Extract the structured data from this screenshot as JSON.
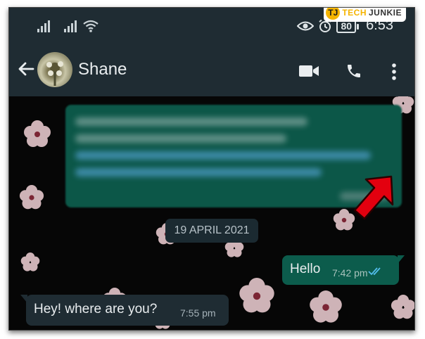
{
  "status_bar": {
    "time": "6:53",
    "battery": "80",
    "icons": [
      "signal-icon",
      "signal-icon",
      "wifi-icon",
      "eye-icon",
      "alarm-icon",
      "battery-icon"
    ]
  },
  "watermark": {
    "text_part1": "TECH",
    "text_part2": "JUNKIE",
    "logo_letters": "TJ"
  },
  "header": {
    "contact_name": "Shane",
    "icons": [
      "back-arrow-icon",
      "video-call-icon",
      "phone-icon",
      "more-options-icon"
    ]
  },
  "chat": {
    "date_chip": "19 APRIL 2021",
    "messages": [
      {
        "direction": "outgoing",
        "text": "Hello",
        "time": "7:42 pm",
        "status_icon": "double-check-icon"
      },
      {
        "direction": "incoming",
        "text": "Hey! where are you?",
        "time": "7:55 pm"
      }
    ]
  },
  "colors": {
    "bar": "#1f2c33",
    "outgoing_bubble": "#0c5c4c",
    "incoming_bubble": "#1f2c33",
    "read_ticks": "#53bdeb",
    "arrow": "#e3000f"
  }
}
